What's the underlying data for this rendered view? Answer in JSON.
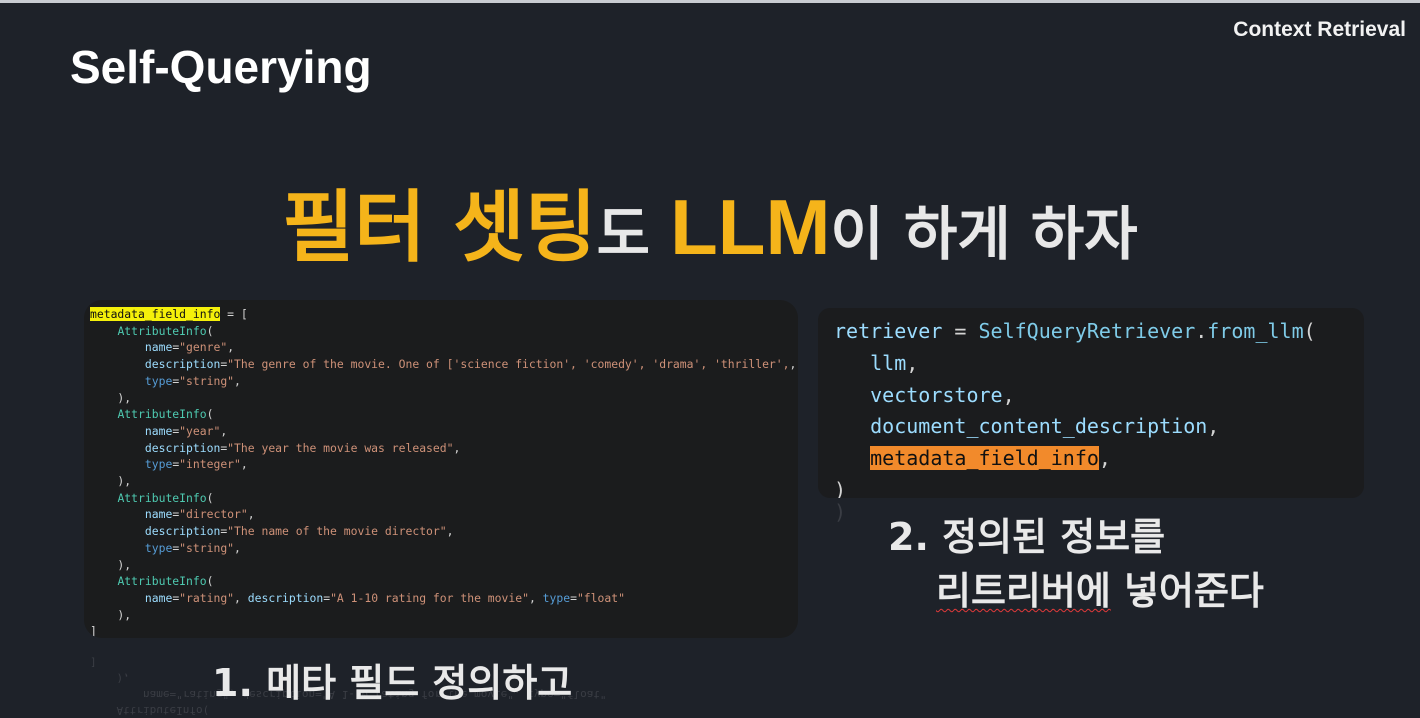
{
  "brand": "Context Retrieval",
  "title": "Self-Querying",
  "headline": {
    "part1": "필터 셋팅",
    "part2": "도 ",
    "part3": "LLM",
    "part4": "이 하게 하자"
  },
  "code_left": {
    "var": "metadata_field_info",
    "lines": [
      {
        "indent": "    ",
        "cls": "AttributeInfo",
        "fields": [
          {
            "name": "name",
            "value": "\"genre\""
          },
          {
            "name": "description",
            "value": "\"The genre of the movie. One of ['science fiction', 'comedy', 'drama', 'thriller',"
          },
          {
            "name": "type",
            "value": "\"string\""
          }
        ]
      },
      {
        "indent": "    ",
        "cls": "AttributeInfo",
        "fields": [
          {
            "name": "name",
            "value": "\"year\""
          },
          {
            "name": "description",
            "value": "\"The year the movie was released\""
          },
          {
            "name": "type",
            "value": "\"integer\""
          }
        ]
      },
      {
        "indent": "    ",
        "cls": "AttributeInfo",
        "fields": [
          {
            "name": "name",
            "value": "\"director\""
          },
          {
            "name": "description",
            "value": "\"The name of the movie director\""
          },
          {
            "name": "type",
            "value": "\"string\""
          }
        ]
      },
      {
        "indent": "    ",
        "cls": "AttributeInfo",
        "single": [
          {
            "name": "name",
            "value": "\"rating\""
          },
          {
            "name": "description",
            "value": "\"A 1-10 rating for the movie\""
          },
          {
            "name": "type",
            "value": "\"float\""
          }
        ]
      }
    ]
  },
  "code_right": {
    "var": "retriever",
    "call": "SelfQueryRetriever",
    "method": "from_llm",
    "args": [
      "llm",
      "vectorstore",
      "document_content_description",
      "metadata_field_info"
    ]
  },
  "captions": {
    "step1": "1. 메타 필드 정의하고",
    "step2_line1": "2. 정의된 정보를",
    "step2_line2a": "리트리버에",
    "step2_line2b": " 넣어준다"
  },
  "colors": {
    "background": "#1e2229",
    "accent": "#f5b41a",
    "highlight_yellow": "#f5f00a",
    "highlight_orange": "#f28a2b"
  }
}
